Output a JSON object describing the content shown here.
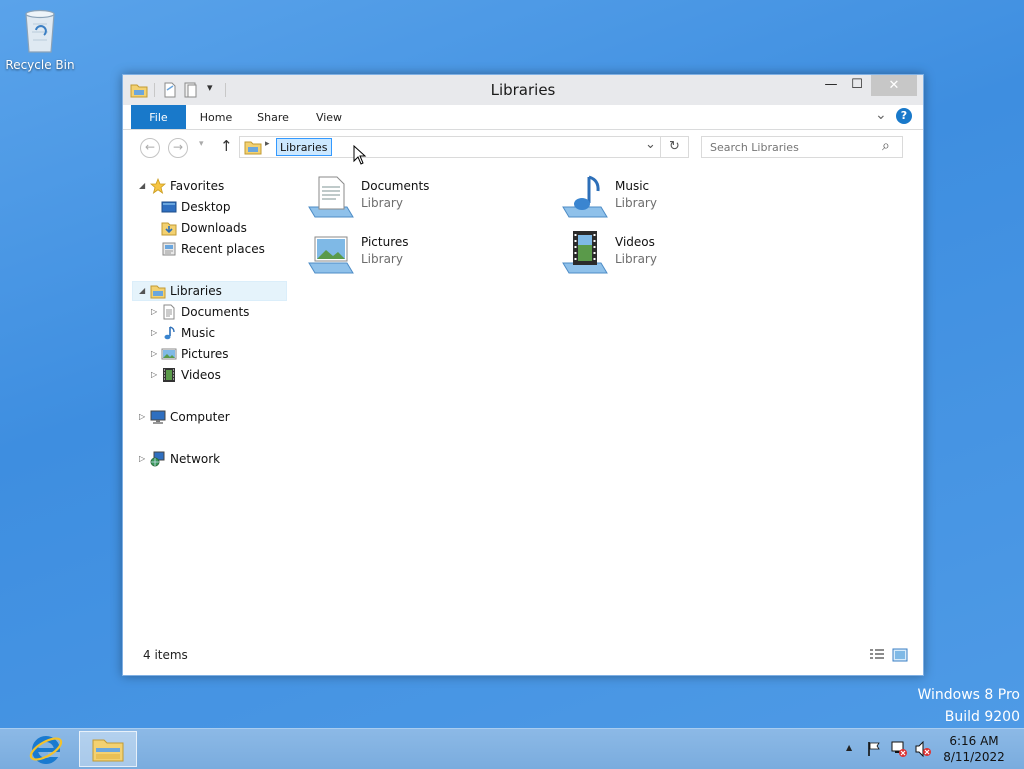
{
  "desktop": {
    "recycle_bin_label": "Recycle Bin"
  },
  "window": {
    "title": "Libraries",
    "minimize_glyph": "—",
    "maximize_glyph": "☐",
    "close_glyph": "✕",
    "quick_access_dropdown": "▾"
  },
  "ribbon": {
    "tabs": [
      "File",
      "Home",
      "Share",
      "View"
    ],
    "expand_glyph": "⌄",
    "help_glyph": "?"
  },
  "address_bar": {
    "back_glyph": "←",
    "forward_glyph": "→",
    "recent_glyph": "▾",
    "up_glyph": "↑",
    "separator_glyph": "▸",
    "path": "Libraries",
    "dropdown_glyph": "⌄",
    "refresh_glyph": "↻"
  },
  "search": {
    "placeholder": "Search Libraries",
    "icon_glyph": "⌕"
  },
  "nav_pane": {
    "favorites": {
      "label": "Favorites",
      "items": [
        "Desktop",
        "Downloads",
        "Recent places"
      ]
    },
    "libraries": {
      "label": "Libraries",
      "items": [
        "Documents",
        "Music",
        "Pictures",
        "Videos"
      ]
    },
    "computer": "Computer",
    "network": "Network",
    "expanded_glyph": "◢",
    "collapsed_glyph": "▷"
  },
  "content": {
    "items": [
      {
        "name": "Documents",
        "type": "Library"
      },
      {
        "name": "Music",
        "type": "Library"
      },
      {
        "name": "Pictures",
        "type": "Library"
      },
      {
        "name": "Videos",
        "type": "Library"
      }
    ]
  },
  "status_bar": {
    "item_count": "4 items"
  },
  "watermark": {
    "line1": "Windows 8 Pro",
    "line2": "Build 9200"
  },
  "taskbar": {
    "tray_up_glyph": "▲",
    "time": "6:16 AM",
    "date": "8/11/2022"
  },
  "colors": {
    "accent": "#1979ca",
    "desktop": "#4a96e4",
    "selection": "#cce8ff"
  }
}
